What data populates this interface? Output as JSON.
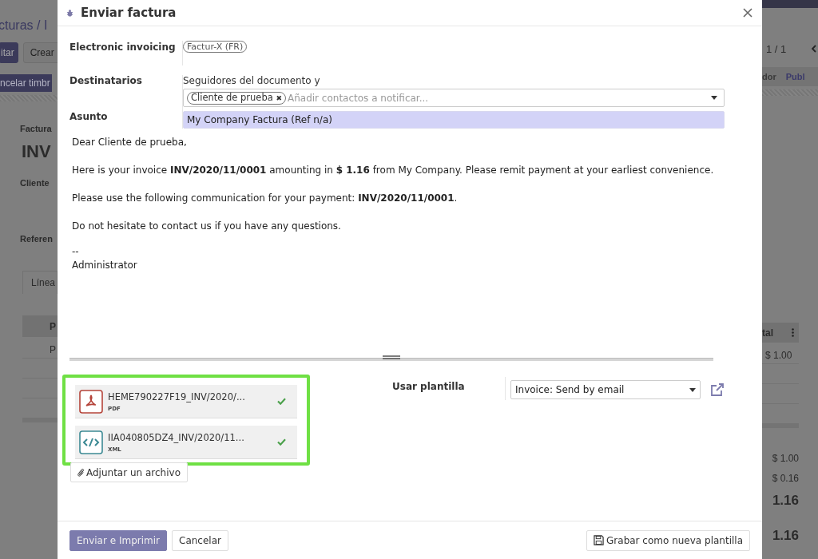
{
  "background": {
    "breadcrumb": "cturas / I",
    "buttons": [
      {
        "label": "itar",
        "primary": true
      },
      {
        "label": "Crear",
        "primary": false
      }
    ],
    "status_button": "ncelar timbr",
    "form_label": "Factura",
    "record_name": "INV",
    "customer_label": "Cliente",
    "reference_label": "Referen",
    "tab": "Línea",
    "table_header": "P",
    "table_cell": "P",
    "pager": "1 / 1",
    "stages": [
      {
        "label": "dor",
        "selected": false
      },
      {
        "label": "Publ",
        "selected": true
      }
    ],
    "column_header": "tal",
    "line_total": "$ 1.00",
    "totals": [
      {
        "value": "$ 1.00",
        "grand": false
      },
      {
        "value": "$ 0.16",
        "grand": false
      },
      {
        "value": "1.16",
        "grand": true
      },
      {
        "value": "1.16",
        "grand": true
      }
    ]
  },
  "dialog": {
    "title": "Enviar factura",
    "electronic_invoicing": {
      "label": "Electronic invoicing",
      "tag": "Factur-X (FR)"
    },
    "recipients": {
      "label": "Destinatarios",
      "note": "Seguidores del documento y",
      "tags": [
        {
          "label": "Cliente de prueba",
          "remove": "✖"
        }
      ],
      "placeholder": "Añadir contactos a notificar..."
    },
    "subject": {
      "label": "Asunto",
      "value": "My Company Factura (Ref n/a)"
    },
    "body": [
      "Dear Cliente de prueba,",
      "Here is your invoice **INV/2020/11/0001** amounting in **$ 1.16** from My Company. Please remit payment at your earliest convenience.",
      "Please use the following communication for your payment: **INV/2020/11/0001**.",
      "Do not hesitate to contact us if you have any questions."
    ],
    "signature": [
      "--",
      "Administrator"
    ],
    "attachments": [
      {
        "kind": "pdf",
        "name": "HEME790227F19_INV/2020/...",
        "type": "PDF",
        "uploaded": true
      },
      {
        "kind": "xml",
        "name": "IIA040805DZ4_INV/2020/11...",
        "type": "XML",
        "uploaded": true
      }
    ],
    "attach_button": "Adjuntar un archivo",
    "template": {
      "label": "Usar plantilla",
      "value": "Invoice: Send by email"
    },
    "buttons": [
      {
        "label": "Enviar e Imprimir",
        "primary": true
      },
      {
        "label": "Cancelar",
        "primary": false
      }
    ],
    "save_template_button": "Grabar como nueva plantilla"
  }
}
